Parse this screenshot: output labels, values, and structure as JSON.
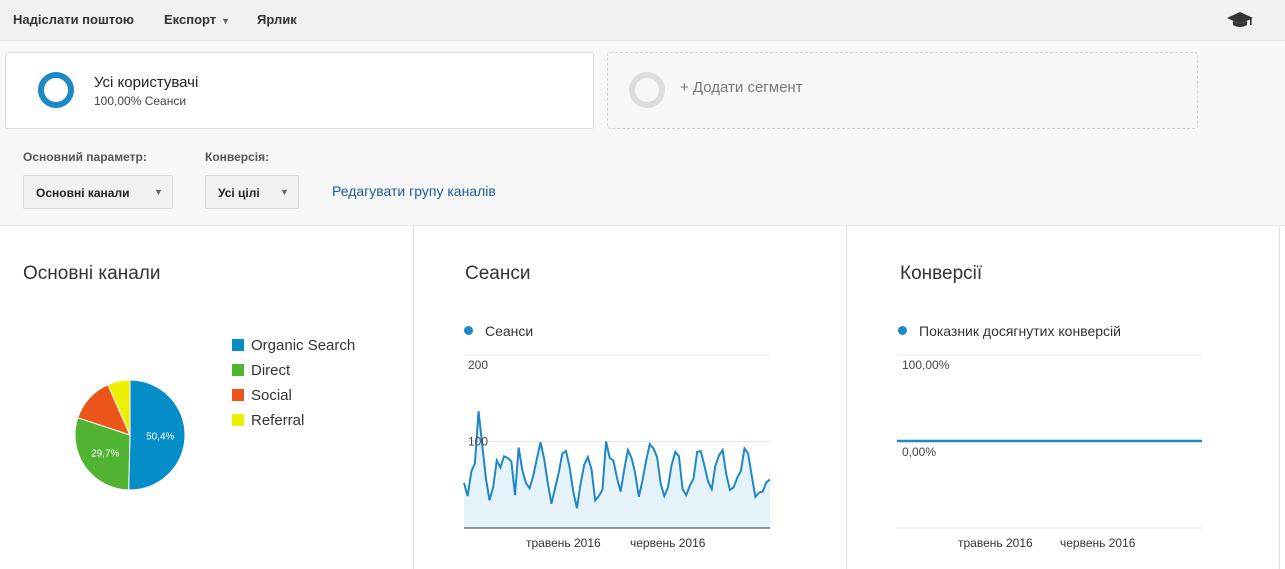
{
  "toolbar": {
    "email": "Надіслати поштою",
    "export": "Експорт",
    "shortcut": "Ярлик",
    "icon": "graduation-cap-icon"
  },
  "segments": {
    "active": {
      "title": "Усі користувачі",
      "subtitle": "100,00% Сеанси",
      "color": "#1e88c7"
    },
    "add_label": "+ Додати сегмент"
  },
  "filters": {
    "primary_label": "Основний параметр:",
    "primary_value": "Основні канали",
    "conversion_label": "Конверсія:",
    "conversion_value": "Усі цілі",
    "edit_link": "Редагувати групу каналів"
  },
  "panels": {
    "channels": {
      "title": "Основні канали",
      "legend": [
        {
          "label": "Organic Search",
          "color": "#058dc7"
        },
        {
          "label": "Direct",
          "color": "#50b432"
        },
        {
          "label": "Social",
          "color": "#ed561b"
        },
        {
          "label": "Referral",
          "color": "#edef00"
        }
      ]
    },
    "sessions": {
      "title": "Сеанси",
      "series": "Сеанси"
    },
    "conversions": {
      "title": "Конверсії",
      "series": "Показник досягнутих конверсій"
    }
  },
  "chart_data": [
    {
      "type": "pie",
      "categories": [
        "Organic Search",
        "Direct",
        "Social",
        "Referral"
      ],
      "values": [
        50.4,
        29.7,
        13.3,
        6.6
      ],
      "data_labels": [
        "50,4%",
        "29,7%",
        "",
        ""
      ],
      "colors": [
        "#058dc7",
        "#50b432",
        "#ed561b",
        "#edef00"
      ]
    },
    {
      "type": "area",
      "series": [
        {
          "name": "Сеанси",
          "values": [
            52,
            37,
            65,
            75,
            135,
            96,
            58,
            32,
            47,
            78,
            70,
            83,
            81,
            77,
            38,
            93,
            67,
            52,
            46,
            60,
            80,
            99,
            80,
            52,
            28,
            46,
            64,
            86,
            89,
            70,
            42,
            23,
            51,
            73,
            82,
            68,
            32,
            37,
            44,
            100,
            81,
            78,
            58,
            42,
            68,
            90,
            81,
            63,
            36,
            55,
            78,
            97,
            92,
            82,
            51,
            37,
            47,
            73,
            88,
            83,
            45,
            38,
            49,
            57,
            88,
            89,
            72,
            54,
            45,
            72,
            84,
            90,
            62,
            44,
            47,
            58,
            66,
            92,
            86,
            60,
            36,
            41,
            42,
            53,
            56
          ]
        }
      ],
      "x_ticks": [
        "травень 2016",
        "червень 2016"
      ],
      "y_ticks": [
        "200",
        "100"
      ],
      "ylim": [
        0,
        200
      ],
      "color": "#1e88c7"
    },
    {
      "type": "line",
      "series": [
        {
          "name": "Показник досягнутих конверсій",
          "values": [
            0,
            0
          ]
        }
      ],
      "x_ticks": [
        "травень 2016",
        "червень 2016"
      ],
      "y_ticks": [
        "100,00%",
        "0,00%"
      ],
      "ylim": [
        0,
        100
      ],
      "color": "#1e88c7"
    }
  ]
}
